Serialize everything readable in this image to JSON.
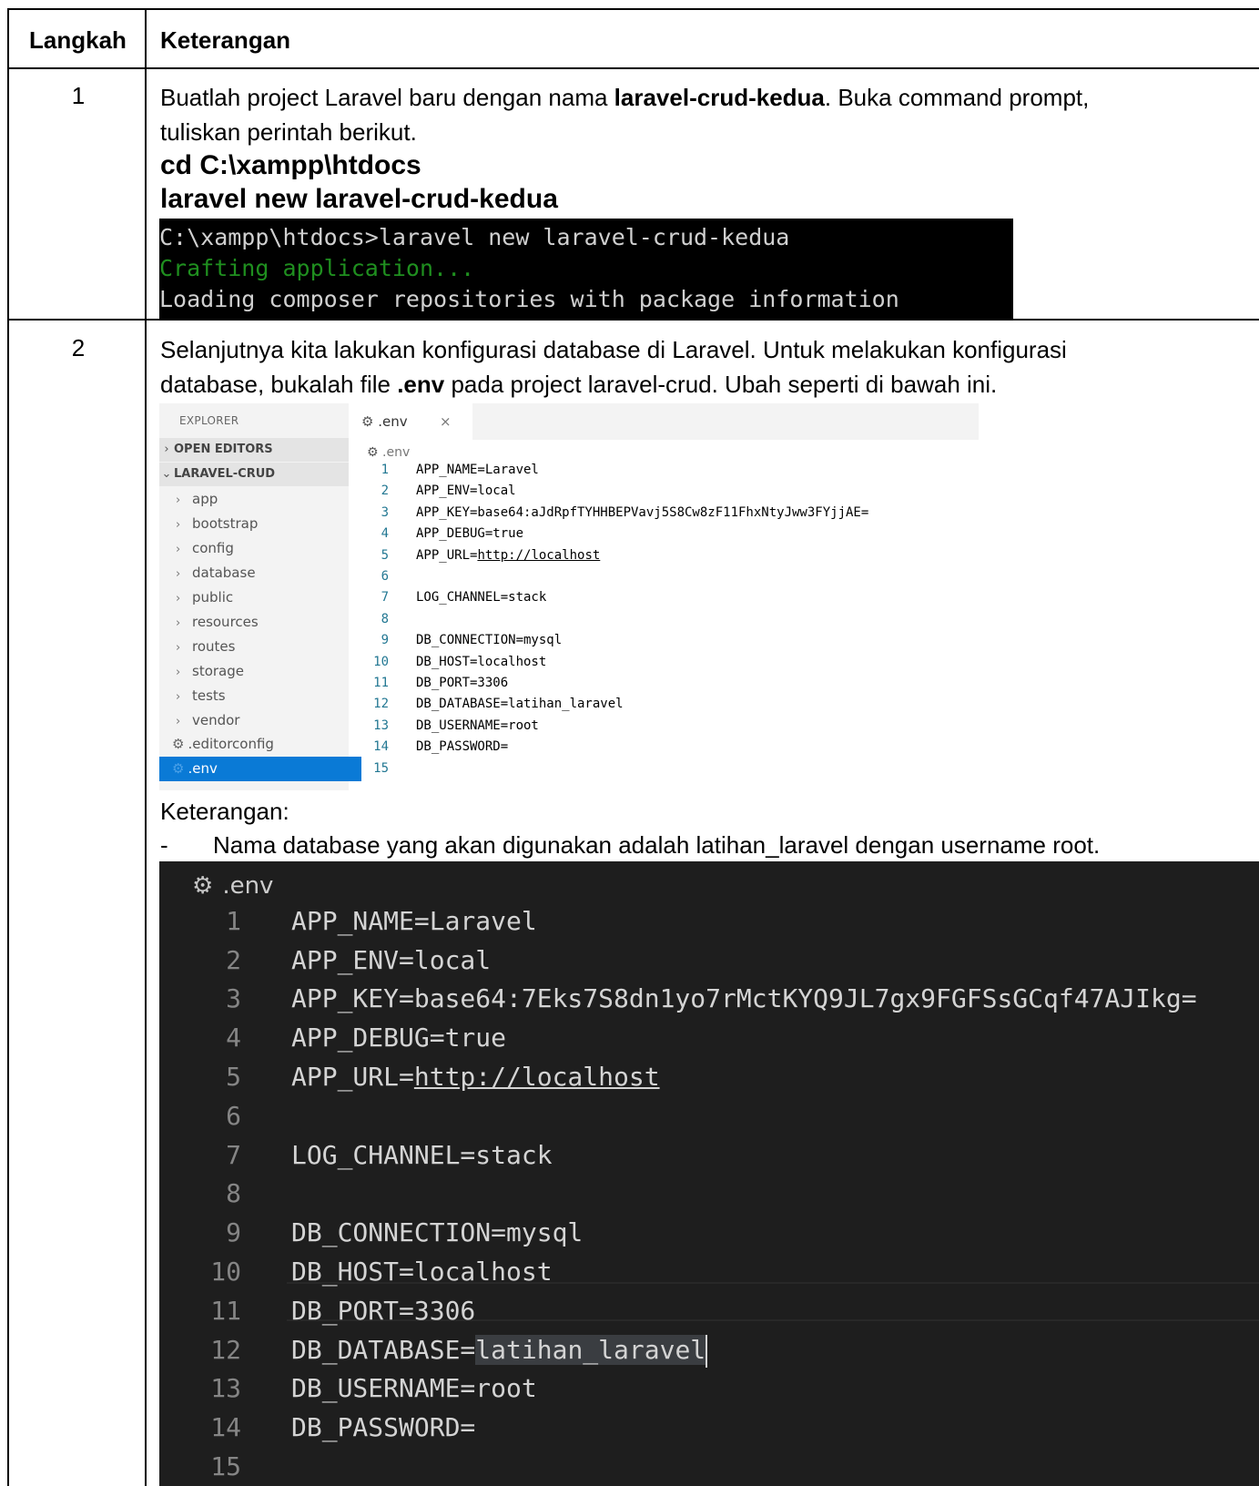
{
  "table": {
    "header": {
      "col1": "Langkah",
      "col2": "Keterangan"
    },
    "rows": [
      {
        "num": "1",
        "intro_a": "Buatlah project Laravel baru dengan nama ",
        "intro_bold": "laravel-crud-kedua",
        "intro_b": ". Buka command prompt,",
        "intro_c": "tuliskan perintah berikut.",
        "cmd1": "cd  C:\\xampp\\htdocs",
        "cmd2": "laravel new laravel-crud-kedua",
        "terminal": {
          "line1": "C:\\xampp\\htdocs>laravel new laravel-crud-kedua",
          "line2": "Crafting application...",
          "line3": "Loading composer repositories with package information"
        }
      },
      {
        "num": "2",
        "intro_a": "Selanjutnya kita lakukan konfigurasi database di Laravel. Untuk melakukan konfigurasi",
        "intro_b": "database, bukalah file ",
        "intro_bold": ".env",
        "intro_c": " pada project laravel-crud. Ubah seperti di bawah ini.",
        "keterangan_label": "Keterangan:",
        "bullet_dash": "-",
        "bullet_text": "Nama database yang akan digunakan adalah latihan_laravel dengan username root."
      }
    ]
  },
  "vscode_light": {
    "explorer_label": "EXPLORER",
    "sections": [
      "OPEN EDITORS",
      "LARAVEL-CRUD"
    ],
    "folders": [
      "app",
      "bootstrap",
      "config",
      "database",
      "public",
      "resources",
      "routes",
      "storage",
      "tests",
      "vendor"
    ],
    "files": [
      ".editorconfig",
      ".env"
    ],
    "selected_file": ".env",
    "tab_label": ".env",
    "tab_close": "×",
    "breadcrumb": ".env",
    "lines": [
      "APP_NAME=Laravel",
      "APP_ENV=local",
      "APP_KEY=base64:aJdRpfTYHHBEPVavj5S8Cw8zF11FhxNtyJww3FYjjAE=",
      "APP_DEBUG=true",
      "APP_URL=http://localhost",
      "",
      "LOG_CHANNEL=stack",
      "",
      "DB_CONNECTION=mysql",
      "DB_HOST=localhost",
      "DB_PORT=3306",
      "DB_DATABASE=latihan_laravel",
      "DB_USERNAME=root",
      "DB_PASSWORD=",
      ""
    ]
  },
  "vscode_dark": {
    "breadcrumb": ".env",
    "lines": [
      "APP_NAME=Laravel",
      "APP_ENV=local",
      "APP_KEY=base64:7Eks7S8dn1yo7rMctKYQ9JL7gx9FGFSsGCqf47AJIkg=",
      "APP_DEBUG=true",
      "APP_URL=http://localhost",
      "",
      "LOG_CHANNEL=stack",
      "",
      "DB_CONNECTION=mysql",
      "DB_HOST=localhost",
      "DB_PORT=3306",
      "DB_DATABASE=latihan_laravel",
      "DB_USERNAME=root",
      "DB_PASSWORD=",
      ""
    ],
    "line_numbers": [
      "1",
      "2",
      "3",
      "4",
      "5",
      "6",
      "7",
      "8",
      "9",
      "10",
      "11",
      "12",
      "13",
      "14",
      "15"
    ]
  },
  "colors": {
    "terminal_bg": "#000000",
    "terminal_green": "#1f8f1f",
    "explorer_selected": "#0a7ad6",
    "dark_editor_bg": "#1e1e1e"
  }
}
